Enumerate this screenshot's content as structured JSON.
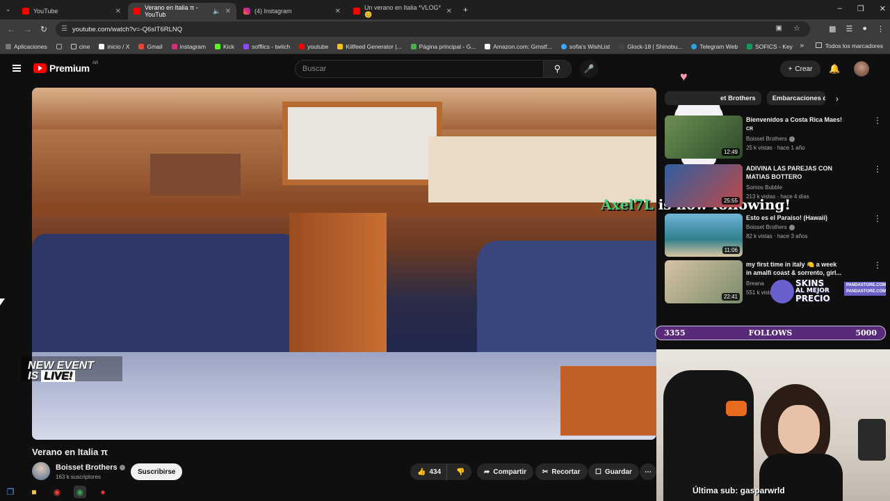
{
  "browser": {
    "tabs": [
      {
        "label": "YouTube",
        "favicon": "youtube-icon",
        "active": false
      },
      {
        "label": "Verano en Italia π - YouTub",
        "favicon": "youtube-icon",
        "active": true
      },
      {
        "label": "(4) Instagram",
        "favicon": "instagram-icon",
        "active": false
      },
      {
        "label": "Un verano en Italia *VLOG* 😊",
        "favicon": "youtube-icon",
        "active": false
      }
    ],
    "url": "youtube.com/watch?v=-Q6sIT6RLNQ",
    "bookmarks": [
      "Aplicaciones",
      "cine",
      "inicio / X",
      "Gmail",
      "instagram",
      "Kick",
      "sofflics - twitch",
      "youtube",
      "Killfeed Generator |...",
      "Página principal - G...",
      "Amazon.com: Grnstf...",
      "sofia's WishList",
      "Glock-18 | Shinobu...",
      "Telegram Web",
      "SOFICS - Key"
    ],
    "bookmarks_all": "Todos los marcadores"
  },
  "youtube": {
    "logo_text": "Premium",
    "logo_country": "AR",
    "search_placeholder": "Buscar",
    "create_label": "Crear",
    "chips": [
      "et Brothers",
      "Embarcaciones d"
    ],
    "recommendations": [
      {
        "title": "Bienvenidos a Costa Rica Maes!",
        "title2": "CR",
        "channel": "Boisset Brothers",
        "meta": "25 k vistas · hace 1 año",
        "duration": "12:49"
      },
      {
        "title": "ADIVINA LAS PAREJAS CON",
        "title2": "MATIAS BOTTERO",
        "channel": "Somos Bubble",
        "meta": "213 k vistas · hace 4 días",
        "duration": "25:55"
      },
      {
        "title": "Esto es el Paraíso! (Hawaii)",
        "title2": "",
        "channel": "Boisset Brothers",
        "meta": "82 k vistas · hace 3 años",
        "duration": "11:06"
      },
      {
        "title": "my first time in italy 🍋 a week",
        "title2": "in amalfi coast & sorrento, girl...",
        "channel": "Breana",
        "meta": "551 k vistas",
        "duration": "22:41"
      }
    ],
    "video": {
      "title": "Verano en Italia π",
      "channel": "Boisset Brothers",
      "subscribers": "163 k suscriptores",
      "subscribe_label": "Suscribirse",
      "likes": "434",
      "share_label": "Compartir",
      "clip_label": "Recortar",
      "save_label": "Guardar"
    }
  },
  "overlay": {
    "follower_name": "Axel7L",
    "follow_message": " is now following!",
    "new_event_line1": "NEW EVENT",
    "new_event_line2a": "IS",
    "new_event_line2b": "LIVE!",
    "follow_goal_current": "3355",
    "follow_goal_label": "FOLLOWS",
    "follow_goal_target": "5000",
    "ad_line1": "SKINS",
    "ad_line2": "AL MEJOR",
    "ad_line3": "PRECIO",
    "ad_store": "PANDASTORE.COM",
    "last_sub": "Última sub: gasparwrld"
  },
  "colors": {
    "youtube_red": "#ff0000",
    "follower_green": "#44d07b",
    "goal_bar": "#5a2a7a"
  }
}
